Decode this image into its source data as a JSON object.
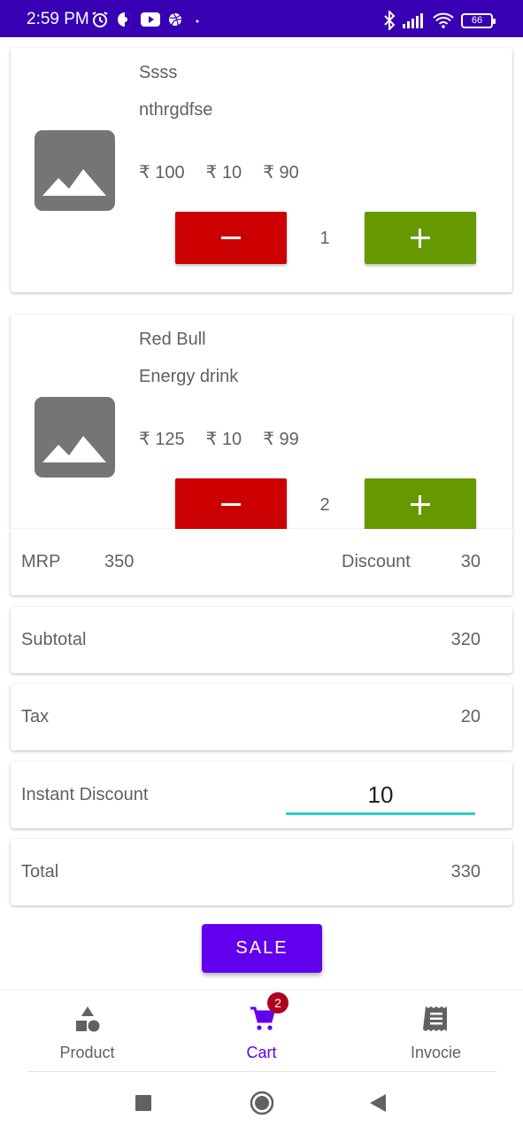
{
  "status_bar": {
    "time": "2:59 PM",
    "battery": "66",
    "background": "#3700b3"
  },
  "cart": {
    "currency": "₹",
    "items": [
      {
        "name": "Ssss",
        "description": "nthrgdfse",
        "mrp": "₹ 100",
        "discount": "₹ 10",
        "price": "₹ 90",
        "quantity": "1"
      },
      {
        "name": "Red Bull",
        "description": "Energy drink",
        "mrp": "₹ 125",
        "discount": "₹ 10",
        "price": "₹ 99",
        "quantity": "2"
      }
    ]
  },
  "summary": {
    "mrp_label": "MRP",
    "mrp_value": "350",
    "discount_label": "Discount",
    "discount_value": "30",
    "subtotal_label": "Subtotal",
    "subtotal_value": "320",
    "tax_label": "Tax",
    "tax_value": "20",
    "instant_discount_label": "Instant Discount",
    "instant_discount_value": "10",
    "total_label": "Total",
    "total_value": "330"
  },
  "sale_button": "SALE",
  "bottom_nav": {
    "items": [
      {
        "label": "Product",
        "icon": "shapes-icon"
      },
      {
        "label": "Cart",
        "icon": "cart-icon",
        "badge": "2",
        "active": true
      },
      {
        "label": "Invocie",
        "icon": "receipt-icon"
      }
    ]
  },
  "colors": {
    "accent": "#6200ee",
    "minus": "#cc0000",
    "plus": "#669900",
    "input_underline": "#2ccfc4",
    "badge": "#b00020"
  }
}
